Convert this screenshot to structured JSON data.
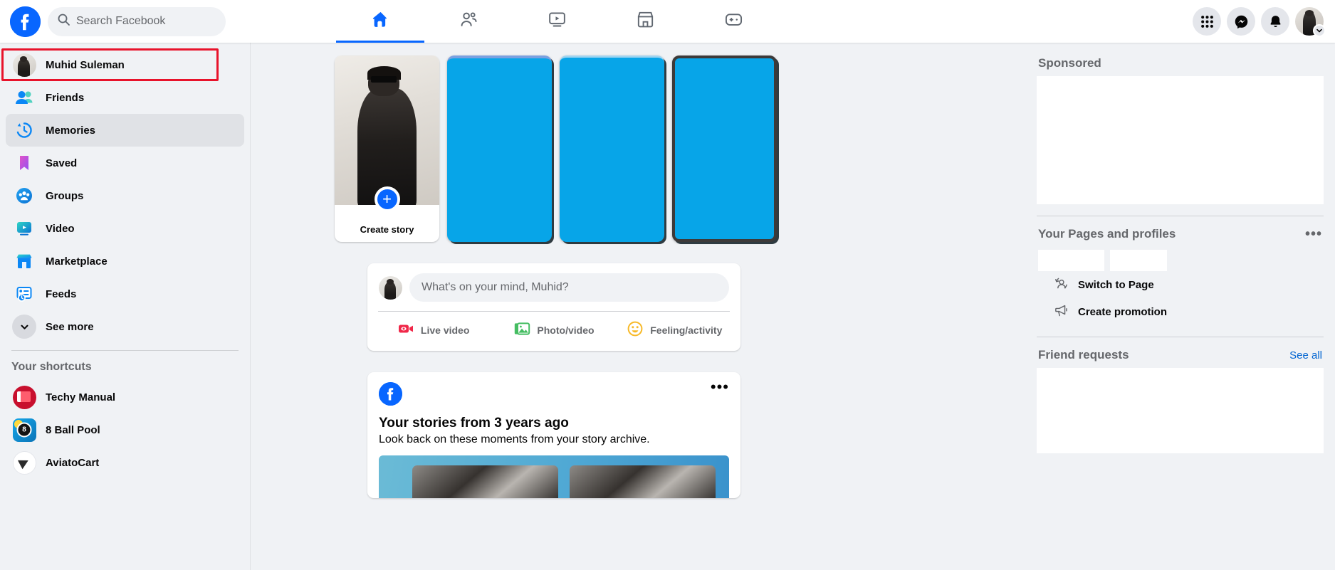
{
  "topbar": {
    "logo_icon": "facebook-logo-icon",
    "search": {
      "icon": "search-icon",
      "placeholder": "Search Facebook",
      "value": "Search Facebook"
    },
    "nav_tabs": [
      {
        "name": "home",
        "icon": "home-icon",
        "active": true
      },
      {
        "name": "friends",
        "icon": "friends-icon",
        "active": false
      },
      {
        "name": "video",
        "icon": "video-icon",
        "active": false
      },
      {
        "name": "marketplace",
        "icon": "marketplace-icon",
        "active": false
      },
      {
        "name": "gaming",
        "icon": "gaming-icon",
        "active": false
      }
    ],
    "right_actions": [
      {
        "name": "menu-grid",
        "icon": "grid-menu-icon"
      },
      {
        "name": "messenger",
        "icon": "messenger-icon"
      },
      {
        "name": "notifications",
        "icon": "bell-icon"
      },
      {
        "name": "account",
        "icon": "avatar-chevron-icon"
      }
    ]
  },
  "sidebar": {
    "items": [
      {
        "label": "Muhid Suleman",
        "icon": "profile-avatar-icon",
        "highlighted": false
      },
      {
        "label": "Friends",
        "icon": "friends-icon",
        "highlighted": false
      },
      {
        "label": "Memories",
        "icon": "memories-clock-icon",
        "highlighted": true
      },
      {
        "label": "Saved",
        "icon": "saved-bookmark-icon",
        "highlighted": false
      },
      {
        "label": "Groups",
        "icon": "groups-icon",
        "highlighted": false
      },
      {
        "label": "Video",
        "icon": "video-icon",
        "highlighted": false
      },
      {
        "label": "Marketplace",
        "icon": "marketplace-icon",
        "highlighted": false
      },
      {
        "label": "Feeds",
        "icon": "feeds-icon",
        "highlighted": false
      }
    ],
    "see_more": {
      "label": "See more",
      "icon": "chevron-down-icon"
    },
    "shortcuts_heading": "Your shortcuts",
    "shortcuts": [
      {
        "label": "Techy Manual",
        "icon": "techy-manual-icon"
      },
      {
        "label": "8 Ball Pool",
        "icon": "8-ball-pool-icon"
      },
      {
        "label": "AviatoCart",
        "icon": "aviatocart-icon"
      }
    ]
  },
  "stories": {
    "create": {
      "label": "Create story",
      "plus_icon": "plus-icon"
    },
    "placeholders": [
      {
        "name": "story-placeholder-1",
        "color": "#07a5e8"
      },
      {
        "name": "story-placeholder-2",
        "color": "#07a5e8"
      },
      {
        "name": "story-placeholder-3",
        "color": "#07a5e8"
      }
    ]
  },
  "composer": {
    "placeholder": "What's on your mind, Muhid?",
    "actions": [
      {
        "label": "Live video",
        "icon": "live-video-icon",
        "color": "#f02849"
      },
      {
        "label": "Photo/video",
        "icon": "photo-video-icon",
        "color": "#45bd62"
      },
      {
        "label": "Feeling/activity",
        "icon": "feeling-activity-icon",
        "color": "#f7b928"
      }
    ]
  },
  "memories_post": {
    "source_icon": "facebook-logo-icon",
    "menu_icon": "more-options-icon",
    "title": "Your stories from 3 years ago",
    "subtitle": "Look back on these moments from your story archive."
  },
  "rightbar": {
    "sponsored": {
      "title": "Sponsored"
    },
    "pages": {
      "title": "Your Pages and profiles",
      "menu_icon": "more-options-icon",
      "actions": [
        {
          "label": "Switch to Page",
          "icon": "switch-page-icon"
        },
        {
          "label": "Create promotion",
          "icon": "megaphone-icon"
        }
      ]
    },
    "friend_requests": {
      "title": "Friend requests",
      "see_all": "See all"
    }
  },
  "colors": {
    "brand_blue": "#0866ff",
    "page_bg": "#f0f2f5",
    "card_bg": "#ffffff",
    "highlight_red": "#e8132b",
    "link_blue": "#0064d1",
    "muted_text": "#65676b"
  }
}
